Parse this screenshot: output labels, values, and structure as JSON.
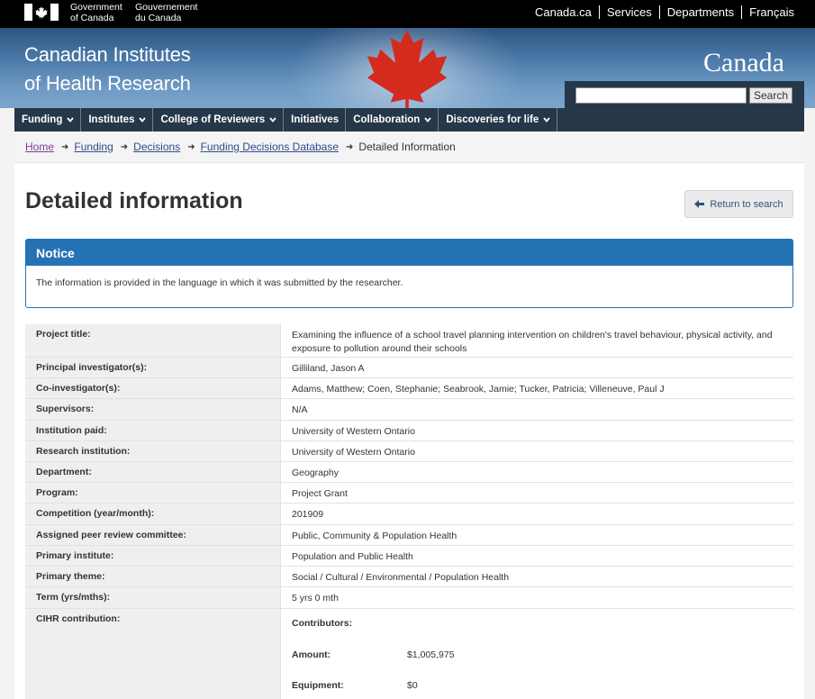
{
  "fip": {
    "gov_en_line1": "Government",
    "gov_en_line2": "of Canada",
    "gov_fr_line1": "Gouvernement",
    "gov_fr_line2": "du Canada",
    "links": [
      "Canada.ca",
      "Services",
      "Departments",
      "Français"
    ]
  },
  "banner": {
    "title_line1": "Canadian Institutes",
    "title_line2": "of Health Research",
    "wordmark": "Canada",
    "search_button": "Search",
    "search_value": ""
  },
  "menu": [
    "Funding",
    "Institutes",
    "College of Reviewers",
    "Initiatives",
    "Collaboration",
    "Discoveries for life"
  ],
  "breadcrumb": {
    "links": [
      "Home",
      "Funding",
      "Decisions",
      "Funding Decisions Database"
    ],
    "current": "Detailed Information"
  },
  "page": {
    "title": "Detailed information",
    "return_label": "Return to search"
  },
  "notice": {
    "title": "Notice",
    "text": "The information is provided in the language in which it was submitted by the researcher."
  },
  "details": [
    {
      "label": "Project title:",
      "value": "Examining the influence of a school travel planning intervention on children's travel behaviour, physical activity, and exposure to pollution around their schools"
    },
    {
      "label": "Principal investigator(s):",
      "value": "Gilliland, Jason A"
    },
    {
      "label": "Co-investigator(s):",
      "value": "Adams, Matthew; Coen, Stephanie; Seabrook, Jamie; Tucker, Patricia; Villeneuve, Paul J"
    },
    {
      "label": "Supervisors:",
      "value": "N/A"
    },
    {
      "label": "Institution paid:",
      "value": "University of Western Ontario"
    },
    {
      "label": "Research institution:",
      "value": "University of Western Ontario"
    },
    {
      "label": "Department:",
      "value": "Geography"
    },
    {
      "label": "Program:",
      "value": "Project Grant"
    },
    {
      "label": "Competition (year/month):",
      "value": "201909"
    },
    {
      "label": "Assigned peer review committee:",
      "value": "Public, Community & Population Health"
    },
    {
      "label": "Primary institute:",
      "value": "Population and Public Health"
    },
    {
      "label": "Primary theme:",
      "value": "Social / Cultural / Environmental / Population Health"
    },
    {
      "label": "Term (yrs/mths):",
      "value": "5 yrs 0 mth"
    }
  ],
  "contribution": {
    "label": "CIHR contribution:",
    "contributors_label": "Contributors:",
    "amount_label": "Amount:",
    "amount_value": "$1,005,975",
    "equipment_label": "Equipment:",
    "equipment_value": "$0"
  },
  "colors": {
    "fip_bg": "#000000",
    "menu_bg": "#26374a",
    "notice_blue": "#2572b4",
    "maple_red": "#d52b1e",
    "label_bg": "#efefef"
  }
}
